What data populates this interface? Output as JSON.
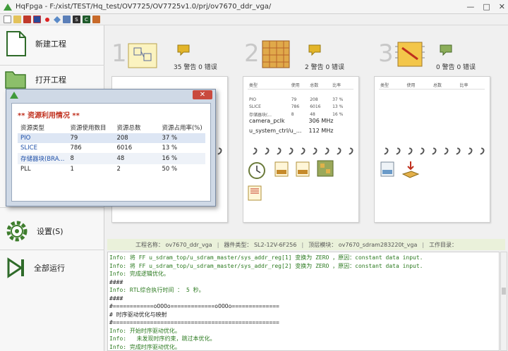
{
  "window": {
    "title": "HqFpga - F:/xist/TEST/Hq_test/OV7725/OV7725v1.0/prj/ov7670_ddr_vga/",
    "minimize": "—",
    "maximize": "□",
    "close": "✕"
  },
  "toolbar": {
    "icons": [
      "new-file-icon",
      "open-folder-icon",
      "flag-icon",
      "uk-flag-icon",
      "red-dot-icon",
      "diamond-icon",
      "chip-icon",
      "s-icon",
      "c-icon",
      "export-icon"
    ],
    "s_label": "S",
    "c_label": "C"
  },
  "sidebar": {
    "items": [
      {
        "label": "新建工程",
        "icon": "new-project-icon"
      },
      {
        "label": "打开工程",
        "icon": "open-project-icon"
      },
      {
        "label": "设置(S)",
        "icon": "settings-gear-icon"
      },
      {
        "label": "全部运行",
        "icon": "run-all-icon"
      }
    ]
  },
  "steps": [
    {
      "number": "1",
      "status": "35 警告 0 错误"
    },
    {
      "number": "2",
      "status": "2 警告 0 错误"
    },
    {
      "number": "3",
      "status": "0 警告 0 错误"
    }
  ],
  "panel2": {
    "headers": [
      "类型",
      "使用",
      "总数",
      "比率"
    ],
    "rows": [
      [
        "PIO",
        "79",
        "208",
        "37 %"
      ],
      [
        "SLICE",
        "786",
        "6016",
        "13 %"
      ],
      [
        "存储器块(...",
        "8",
        "48",
        "16 %"
      ]
    ],
    "clocks": [
      {
        "name": "camera_pclk",
        "freq": "306 MHz"
      },
      {
        "name": "u_system_ctrl/u_...",
        "freq": "112 MHz"
      }
    ],
    "files": [
      "BBS RPT",
      "RPT",
      "NCL"
    ]
  },
  "panel3": {
    "headers": [
      "类型",
      "使用",
      "总数",
      "比率"
    ],
    "files": [
      "BIT"
    ]
  },
  "dialog": {
    "heading": "** 资源利用情况 **",
    "headers": [
      "资源类型",
      "资源使用数目",
      "资源总数",
      "资源占用率(%)"
    ],
    "rows": [
      [
        "PIO",
        "79",
        "208",
        "37 %"
      ],
      [
        "SLICE",
        "786",
        "6016",
        "13 %"
      ],
      [
        "存储器块(BRA...",
        "8",
        "48",
        "16 %"
      ],
      [
        "PLL",
        "1",
        "2",
        "50 %"
      ]
    ]
  },
  "info_bar": {
    "project": "工程名称： ov7670_ddr_vga",
    "device": "器件类型： SL2-12V-6F256",
    "top": "顶层模块： ov7670_sdram283220t_vga",
    "workdir": "工作目录："
  },
  "log": [
    {
      "kind": "info",
      "text": "Info: 将 FF u_sdram_top/u_sdram_master/sys_addr_reg[1] 变换为 ZERO ，原因：constant data input."
    },
    {
      "kind": "info",
      "text": "Info: 将 FF u_sdram_top/u_sdram_master/sys_addr_reg[2] 变换为 ZERO ，原因：constant data input."
    },
    {
      "kind": "info",
      "text": "Info: 完成逻辑优化。"
    },
    {
      "kind": "plain",
      "text": "####"
    },
    {
      "kind": "info",
      "text": "Info: RTL综合执行时间 ： 5 秒。"
    },
    {
      "kind": "plain",
      "text": "####"
    },
    {
      "kind": "plain",
      "text": "#============oOOOo=============oOOOo=============="
    },
    {
      "kind": "plain",
      "text": "# 时序驱动优化与映射"
    },
    {
      "kind": "plain",
      "text": "#================================================="
    },
    {
      "kind": "info",
      "text": "Info: 开始时序驱动优化。"
    },
    {
      "kind": "info",
      "text": "Info:   未发现时序约束，跳过本优化。"
    },
    {
      "kind": "info",
      "text": "Info: 完成时序驱动优化。"
    }
  ]
}
